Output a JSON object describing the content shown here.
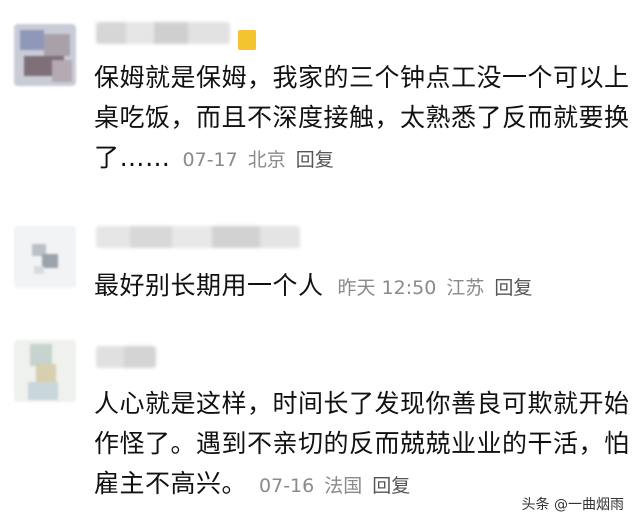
{
  "comments": [
    {
      "text": "保姆就是保姆，我家的三个钟点工没一个可以上桌吃饭，而且不深度接触，太熟悉了反而就要换了……",
      "date": "07-17",
      "location": "北京",
      "reply_label": "回复"
    },
    {
      "text": "最好别长期用一个人",
      "date": "昨天 12:50",
      "location": "江苏",
      "reply_label": "回复"
    },
    {
      "text": "人心就是这样，时间长了发现你善良可欺就开始作怪了。遇到不亲切的反而兢兢业业的干活，怕雇主不高兴。",
      "date": "07-16",
      "location": "法国",
      "reply_label": "回复"
    }
  ],
  "watermark": "头条 @一曲烟雨",
  "colors": {
    "text": "#111111",
    "meta": "#8a8a8a",
    "badge": "#f4c430"
  }
}
